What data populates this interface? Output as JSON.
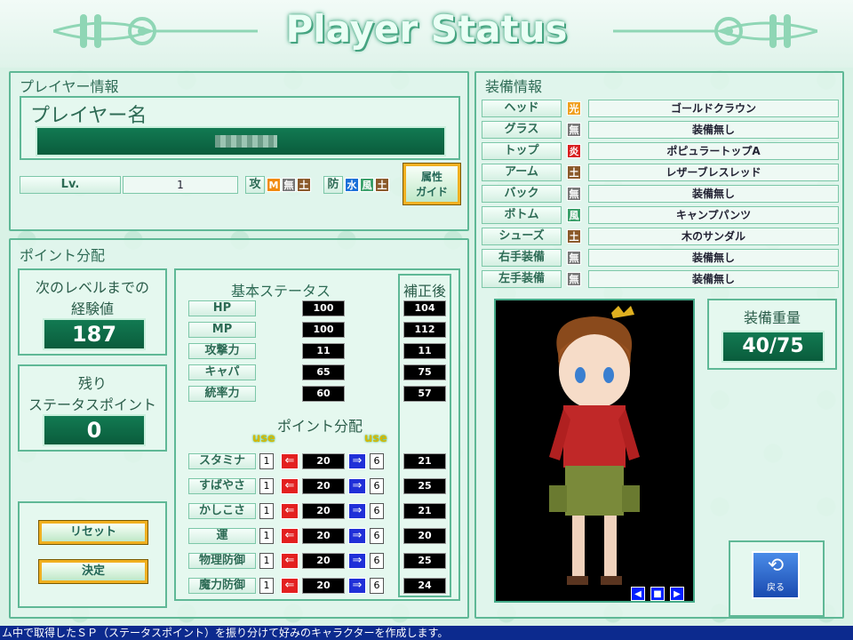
{
  "title": "Player Status",
  "player_panel": {
    "heading": "プレイヤー情報",
    "name_label": "プレイヤー名",
    "name_value": "",
    "lv_label": "Lv.",
    "lv_value": "1",
    "atk_label": "攻",
    "atk_chips": [
      {
        "t": "M",
        "c": "#f08a10"
      },
      {
        "t": "無",
        "c": "#777"
      },
      {
        "t": "土",
        "c": "#8b5a2b"
      }
    ],
    "def_label": "防",
    "def_chips": [
      {
        "t": "水",
        "c": "#1a6fd8"
      },
      {
        "t": "風",
        "c": "#3aa06a"
      },
      {
        "t": "土",
        "c": "#8b5a2b"
      }
    ],
    "guide_line1": "属性",
    "guide_line2": "ガイド"
  },
  "points_panel": {
    "heading": "ポイント分配",
    "exp_title1": "次のレベルまでの",
    "exp_title2": "経験値",
    "exp_value": "187",
    "sp_title1": "残り",
    "sp_title2": "ステータスポイント",
    "sp_value": "0",
    "reset_label": "リセット",
    "confirm_label": "決定"
  },
  "base_status": {
    "heading": "基本ステータス",
    "after_heading": "補正後",
    "rows": [
      {
        "name": "HP",
        "base": "100",
        "after": "104"
      },
      {
        "name": "MP",
        "base": "100",
        "after": "112"
      },
      {
        "name": "攻撃力",
        "base": "11",
        "after": "11"
      },
      {
        "name": "キャパ",
        "base": "65",
        "after": "75"
      },
      {
        "name": "統率力",
        "base": "60",
        "after": "57"
      }
    ]
  },
  "alloc": {
    "heading": "ポイント分配",
    "use_left": "use",
    "use_right": "use",
    "rows": [
      {
        "name": "スタミナ",
        "use": "1",
        "val": "20",
        "use2": "6",
        "after": "21"
      },
      {
        "name": "すばやさ",
        "use": "1",
        "val": "20",
        "use2": "6",
        "after": "25"
      },
      {
        "name": "かしこさ",
        "use": "1",
        "val": "20",
        "use2": "6",
        "after": "21"
      },
      {
        "name": "運",
        "use": "1",
        "val": "20",
        "use2": "6",
        "after": "20"
      },
      {
        "name": "物理防御",
        "use": "1",
        "val": "20",
        "use2": "6",
        "after": "25"
      },
      {
        "name": "魔力防御",
        "use": "1",
        "val": "20",
        "use2": "6",
        "after": "24"
      }
    ]
  },
  "equipment": {
    "heading": "装備情報",
    "rows": [
      {
        "slot": "ヘッド",
        "chip": "光",
        "c": "#f0a020",
        "item": "ゴールドクラウン"
      },
      {
        "slot": "グラス",
        "chip": "無",
        "c": "#777",
        "item": "装備無し"
      },
      {
        "slot": "トップ",
        "chip": "炎",
        "c": "#d82020",
        "item": "ポピュラートップA"
      },
      {
        "slot": "アーム",
        "chip": "土",
        "c": "#8b5a2b",
        "item": "レザーブレスレッド"
      },
      {
        "slot": "バック",
        "chip": "無",
        "c": "#777",
        "item": "装備無し"
      },
      {
        "slot": "ボトム",
        "chip": "風",
        "c": "#3aa06a",
        "item": "キャンプパンツ"
      },
      {
        "slot": "シューズ",
        "chip": "土",
        "c": "#8b5a2b",
        "item": "木のサンダル"
      },
      {
        "slot": "右手装備",
        "chip": "無",
        "c": "#777",
        "item": "装備無し"
      },
      {
        "slot": "左手装備",
        "chip": "無",
        "c": "#777",
        "item": "装備無し"
      }
    ],
    "weight_label": "装備重量",
    "weight_value": "40/75",
    "back_label": "戻る"
  },
  "footer": "ム中で取得したＳＰ（ステータスポイント）を振り分けて好みのキャラクターを作成します。"
}
